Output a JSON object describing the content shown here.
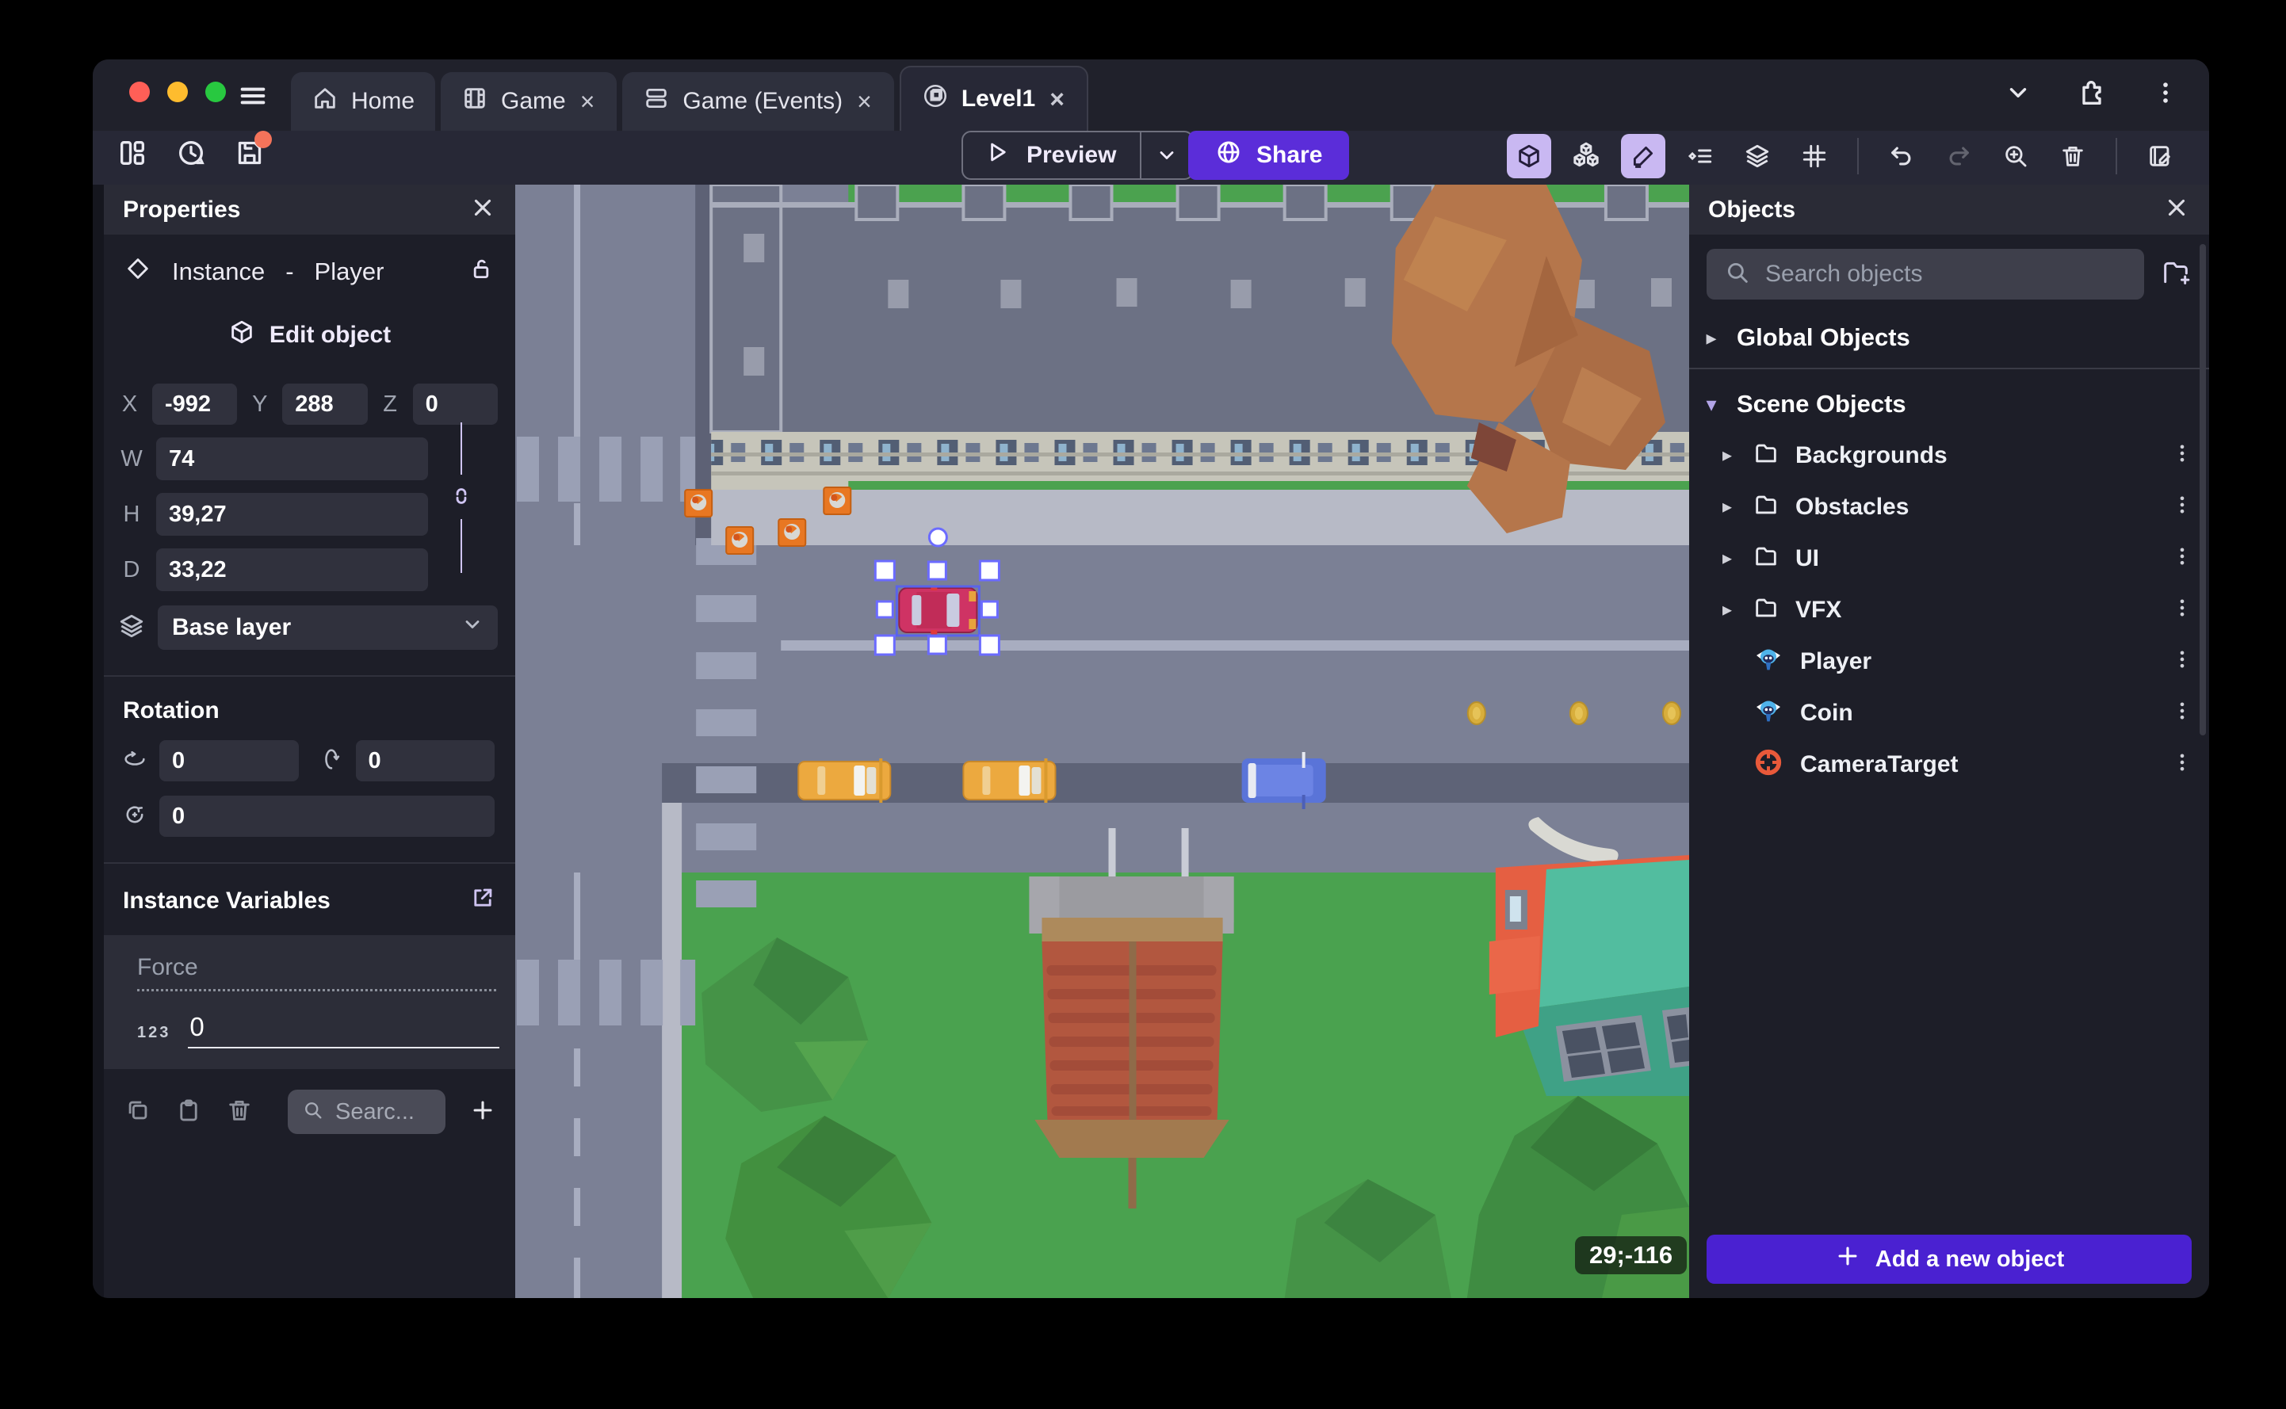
{
  "titlebar": {
    "tabs": [
      {
        "label": "Home",
        "closable": false
      },
      {
        "label": "Game",
        "closable": true
      },
      {
        "label": "Game (Events)",
        "closable": true
      },
      {
        "label": "Level1",
        "closable": true
      }
    ],
    "close_symbol": "×"
  },
  "toolbar": {
    "preview_label": "Preview",
    "share_label": "Share"
  },
  "properties": {
    "title": "Properties",
    "close": "×",
    "instance_label": "Instance",
    "dash": "-",
    "instance_name": "Player",
    "edit_object_label": "Edit object",
    "x_label": "X",
    "x_value": "-992",
    "y_label": "Y",
    "y_value": "288",
    "z_label": "Z",
    "z_value": "0",
    "w_label": "W",
    "w_value": "74",
    "h_label": "H",
    "h_value": "39,27",
    "d_label": "D",
    "d_value": "33,22",
    "layer_value": "Base layer",
    "rotation_title": "Rotation",
    "rot_x": "0",
    "rot_y": "0",
    "rot_z": "0",
    "variables_title": "Instance Variables",
    "variable_name": "Force",
    "variable_type": "123",
    "variable_value": "0",
    "variables_search_placeholder": "Searc..."
  },
  "objects": {
    "title": "Objects",
    "close": "×",
    "search_placeholder": "Search objects",
    "global_group": "Global Objects",
    "scene_group": "Scene Objects",
    "folders": [
      {
        "label": "Backgrounds"
      },
      {
        "label": "Obstacles"
      },
      {
        "label": "UI"
      },
      {
        "label": "VFX"
      }
    ],
    "items": [
      {
        "label": "Player"
      },
      {
        "label": "Coin"
      },
      {
        "label": "CameraTarget"
      }
    ],
    "add_button_label": "Add a new object"
  },
  "canvas": {
    "coordinate_badge": "29;-116"
  },
  "colors": {
    "accent_purple": "#5b2dd9",
    "add_button_purple": "#4a21d1",
    "selection_blue": "#5f6cf0",
    "save_badge_orange": "#f4735a",
    "toggle_active_lavender": "#c9b8f2",
    "traffic_red": "#ff5f57",
    "traffic_yellow": "#febc2e",
    "traffic_green": "#28c840"
  }
}
